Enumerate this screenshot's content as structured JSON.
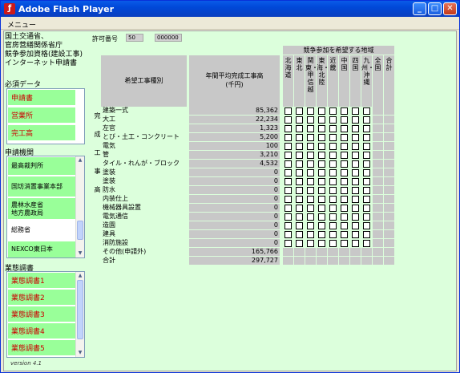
{
  "window": {
    "title": "Adobe Flash Player",
    "menu": "メニュー"
  },
  "org": [
    "国土交通省、",
    "官房营繕関係省庁",
    "競争参加資格(建設工事)",
    "インターネット申請書"
  ],
  "version": "version 4.1",
  "required": {
    "label": "必須データ",
    "items": [
      "申請書",
      "営業所",
      "完工高"
    ]
  },
  "apply": {
    "label": "申請機関",
    "items": [
      "最高裁判所",
      "国坊消置事業本部",
      "農林水産省\n地方農政局",
      "総務省",
      "NEXCO東日本"
    ]
  },
  "survey": {
    "label": "業態調書",
    "items": [
      "業態調書1",
      "業態調書2",
      "業態調書3",
      "業態調書4",
      "業態調書5"
    ]
  },
  "permit": {
    "label": "許可番号",
    "part1": "50",
    "part2": "000000"
  },
  "table": {
    "type_header": "希望工事種別",
    "amount_header": "年間平均完成工事高\n(千円)",
    "region_header": "競争参加を希望する地域",
    "side_label": [
      "完",
      "成",
      "工",
      "事",
      "高"
    ],
    "regions": [
      "北海道",
      "東北",
      "関東・甲信越",
      "東海・北陸",
      "近畿",
      "中国",
      "四国",
      "九州・沖縄",
      "全国",
      "合計"
    ],
    "rows": [
      {
        "name": "建築一式",
        "value": "85,362"
      },
      {
        "name": "大工",
        "value": "22,234"
      },
      {
        "name": "左官",
        "value": "1,323"
      },
      {
        "name": "とび・土工・コンクリート",
        "value": "5,200"
      },
      {
        "name": "電気",
        "value": "100"
      },
      {
        "name": "管",
        "value": "3,210"
      },
      {
        "name": "タイル・れんが・ブロック",
        "value": "4,532"
      },
      {
        "name": "塗装",
        "value": "0"
      },
      {
        "name": "塗装",
        "value": "0"
      },
      {
        "name": "防水",
        "value": "0"
      },
      {
        "name": "内装仕上",
        "value": "0"
      },
      {
        "name": "機械器具設置",
        "value": "0"
      },
      {
        "name": "電気通信",
        "value": "0"
      },
      {
        "name": "造園",
        "value": "0"
      },
      {
        "name": "建具",
        "value": "0"
      },
      {
        "name": "消防施設",
        "value": "0"
      },
      {
        "name": "その他(申請外)",
        "value": "165,766"
      },
      {
        "name": "合計",
        "value": "297,727"
      }
    ]
  }
}
